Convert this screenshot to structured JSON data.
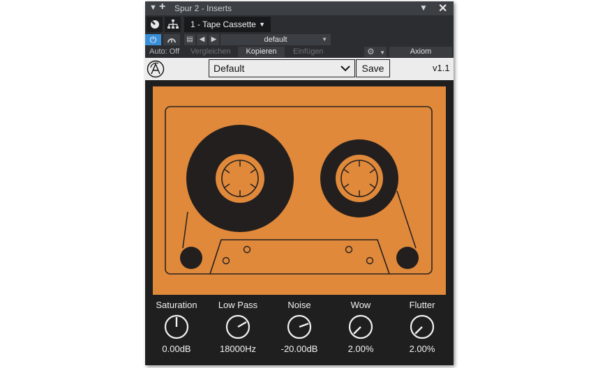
{
  "titlebar": {
    "title": "Spur 2 - Inserts",
    "collapse_icon": "triangle-down",
    "add_icon": "plus",
    "pin_icon": "pin",
    "close_icon": "x"
  },
  "toolbar": {
    "preset_tab_label": "1 - Tape Cassette",
    "preset_name": "default",
    "auto_label": "Auto: Off",
    "compare_label": "Vergleichen",
    "copy_label": "Kopieren",
    "paste_label": "Einfügen",
    "device_label": "Axiom"
  },
  "plugin": {
    "preset_select": "Default",
    "save_label": "Save",
    "version": "v1.1"
  },
  "knobs": [
    {
      "label": "Saturation",
      "value": "0.00dB",
      "angle": 0
    },
    {
      "label": "Low Pass",
      "value": "18000Hz",
      "angle": 60
    },
    {
      "label": "Noise",
      "value": "-20.00dB",
      "angle": 70
    },
    {
      "label": "Wow",
      "value": "2.00%",
      "angle": -135
    },
    {
      "label": "Flutter",
      "value": "2.00%",
      "angle": -135
    }
  ],
  "colors": {
    "cassette_orange": "#e0893b",
    "panel_dark": "#1f1f1f",
    "accent_blue": "#3a8fd8"
  }
}
